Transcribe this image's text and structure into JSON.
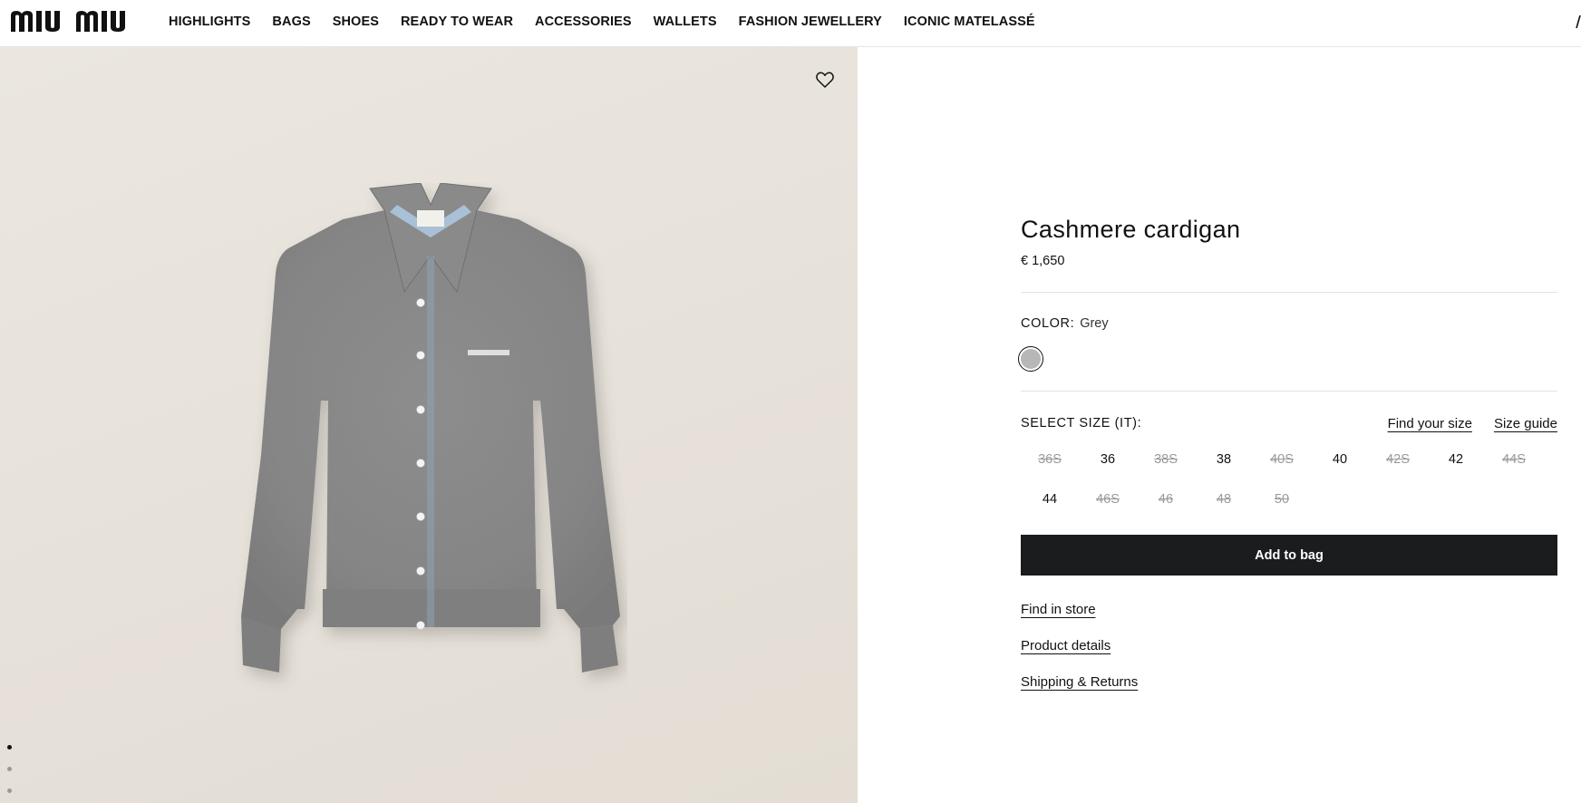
{
  "brand": {
    "logo_text": "MIU MIU"
  },
  "nav": {
    "items": [
      "HIGHLIGHTS",
      "BAGS",
      "SHOES",
      "READY TO WEAR",
      "ACCESSORIES",
      "WALLETS",
      "FASHION JEWELLERY",
      "ICONIC MATELASSÉ"
    ]
  },
  "gallery": {
    "wishlist_icon": "heart-icon",
    "image_subject": "grey cashmere cardigan",
    "dots": 3,
    "active_dot": 0
  },
  "product": {
    "title": "Cashmere cardigan",
    "price": "€ 1,650"
  },
  "color": {
    "label": "COLOR:",
    "value": "Grey",
    "swatch_hex": "#b7b7b7"
  },
  "size": {
    "label": "SELECT SIZE (IT):",
    "find_your_size": "Find your size",
    "size_guide": "Size guide",
    "options": [
      {
        "label": "36S",
        "available": false
      },
      {
        "label": "36",
        "available": true
      },
      {
        "label": "38S",
        "available": false
      },
      {
        "label": "38",
        "available": true
      },
      {
        "label": "40S",
        "available": false
      },
      {
        "label": "40",
        "available": true
      },
      {
        "label": "42S",
        "available": false
      },
      {
        "label": "42",
        "available": true
      },
      {
        "label": "44S",
        "available": false
      },
      {
        "label": "44",
        "available": true
      },
      {
        "label": "46S",
        "available": false
      },
      {
        "label": "46",
        "available": false
      },
      {
        "label": "48",
        "available": false
      },
      {
        "label": "50",
        "available": false
      }
    ]
  },
  "actions": {
    "add_to_bag": "Add to bag",
    "find_in_store": "Find in store",
    "product_details": "Product details",
    "shipping_returns": "Shipping & Returns"
  },
  "colors": {
    "button_bg": "#1b1c1e",
    "gallery_bg": "#e8e3db",
    "unavailable_text": "#9a9a9a"
  }
}
